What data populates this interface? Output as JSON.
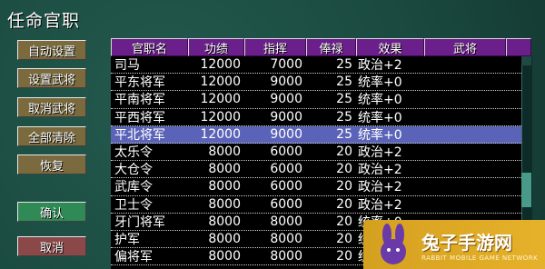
{
  "title": "任命官职",
  "buttons": {
    "auto": "自动设置",
    "set_general": "设置武将",
    "cancel_general": "取消武将",
    "clear_all": "全部清除",
    "restore": "恢复",
    "confirm": "确认",
    "cancel": "取消"
  },
  "table": {
    "headers": [
      "官职名",
      "功绩",
      "指挥",
      "俸禄",
      "效果",
      "武将"
    ],
    "rows": [
      {
        "name": "司马",
        "merit": "12000",
        "command": "7000",
        "salary": "25",
        "effect": "政治+2",
        "general": ""
      },
      {
        "name": "平东将军",
        "merit": "12000",
        "command": "9000",
        "salary": "25",
        "effect": "统率+0",
        "general": ""
      },
      {
        "name": "平南将军",
        "merit": "12000",
        "command": "9000",
        "salary": "25",
        "effect": "统率+0",
        "general": ""
      },
      {
        "name": "平西将军",
        "merit": "12000",
        "command": "9000",
        "salary": "25",
        "effect": "统率+0",
        "general": ""
      },
      {
        "name": "平北将军",
        "merit": "12000",
        "command": "9000",
        "salary": "25",
        "effect": "统率+0",
        "general": ""
      },
      {
        "name": "太乐令",
        "merit": "8000",
        "command": "6000",
        "salary": "20",
        "effect": "政治+2",
        "general": ""
      },
      {
        "name": "大仓令",
        "merit": "8000",
        "command": "6000",
        "salary": "20",
        "effect": "政治+2",
        "general": ""
      },
      {
        "name": "武库令",
        "merit": "8000",
        "command": "6000",
        "salary": "20",
        "effect": "政治+2",
        "general": ""
      },
      {
        "name": "卫士令",
        "merit": "8000",
        "command": "6000",
        "salary": "20",
        "effect": "政治+2",
        "general": ""
      },
      {
        "name": "牙门将军",
        "merit": "8000",
        "command": "8000",
        "salary": "20",
        "effect": "统率+0",
        "general": ""
      },
      {
        "name": "护军",
        "merit": "8000",
        "command": "8000",
        "salary": "20",
        "effect": "统率+0",
        "general": ""
      },
      {
        "name": "偏将军",
        "merit": "8000",
        "command": "8000",
        "salary": "20",
        "effect": "统率+0",
        "general": ""
      }
    ],
    "selected_index": 4
  },
  "watermark": {
    "cn": "兔子手游网",
    "en": "RABBIT MOBILE GAME NETWORK"
  },
  "colors": {
    "header_bg": "#6b1f8a",
    "selected_row": "#5b63b8",
    "background": "#1a4a40"
  },
  "icons": [
    "rabbit-logo-icon"
  ]
}
